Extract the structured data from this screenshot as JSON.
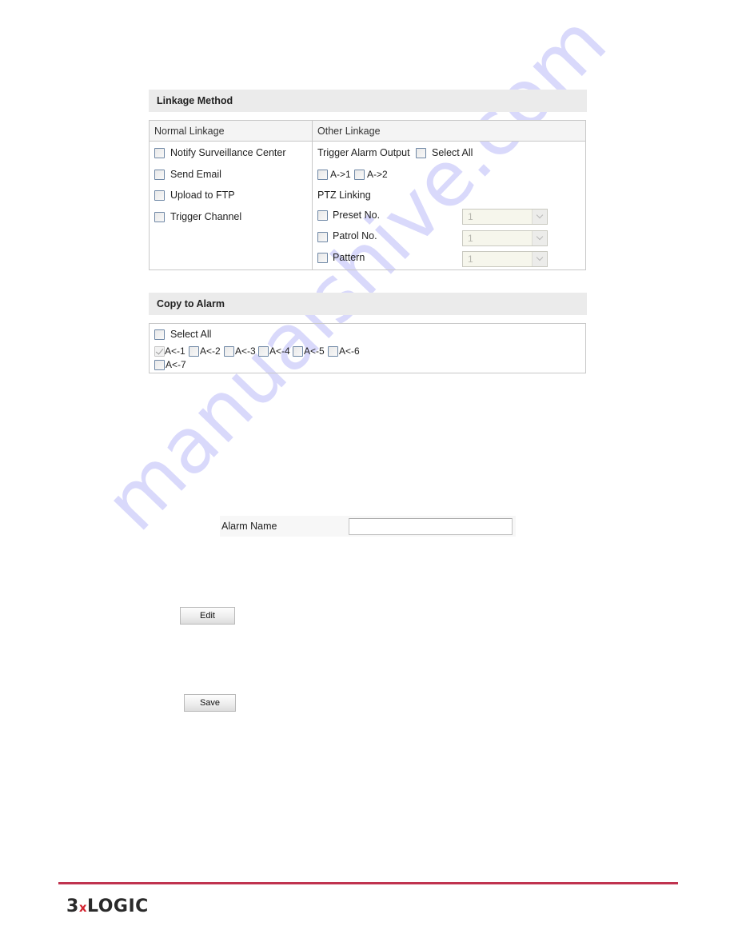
{
  "linkage_method": {
    "title": "Linkage Method",
    "normal_linkage": {
      "header": "Normal Linkage",
      "items": [
        {
          "label": "Notify Surveillance Center",
          "checked": false
        },
        {
          "label": "Send Email",
          "checked": false
        },
        {
          "label": "Upload to FTP",
          "checked": false
        },
        {
          "label": "Trigger Channel",
          "checked": false
        }
      ]
    },
    "other_linkage": {
      "header": "Other Linkage",
      "trigger_alarm_output_label": "Trigger Alarm Output",
      "select_all_label": "Select All",
      "outputs": [
        {
          "label": "A->1",
          "checked": false
        },
        {
          "label": "A->2",
          "checked": false
        }
      ],
      "ptz_linking_label": "PTZ Linking",
      "ptz": [
        {
          "label": "Preset No.",
          "checked": false,
          "value": "1"
        },
        {
          "label": "Patrol No.",
          "checked": false,
          "value": "1"
        },
        {
          "label": "Pattern",
          "checked": false,
          "value": "1"
        }
      ]
    }
  },
  "copy_to_alarm": {
    "title": "Copy to Alarm",
    "select_all_label": "Select All",
    "alarms": [
      {
        "label": "A<-1",
        "checked": true,
        "disabled": true
      },
      {
        "label": "A<-2",
        "checked": false
      },
      {
        "label": "A<-3",
        "checked": false
      },
      {
        "label": "A<-4",
        "checked": false
      },
      {
        "label": "A<-5",
        "checked": false
      },
      {
        "label": "A<-6",
        "checked": false
      },
      {
        "label": "A<-7",
        "checked": false
      }
    ]
  },
  "alarm_name": {
    "label": "Alarm Name",
    "value": ""
  },
  "buttons": {
    "edit": "Edit",
    "save": "Save"
  },
  "footer": {
    "logo_prefix": "3",
    "logo_x": "x",
    "logo_suffix": "LOGIC",
    "rule_color": "#c0334f"
  },
  "watermark": "manualshive.com"
}
